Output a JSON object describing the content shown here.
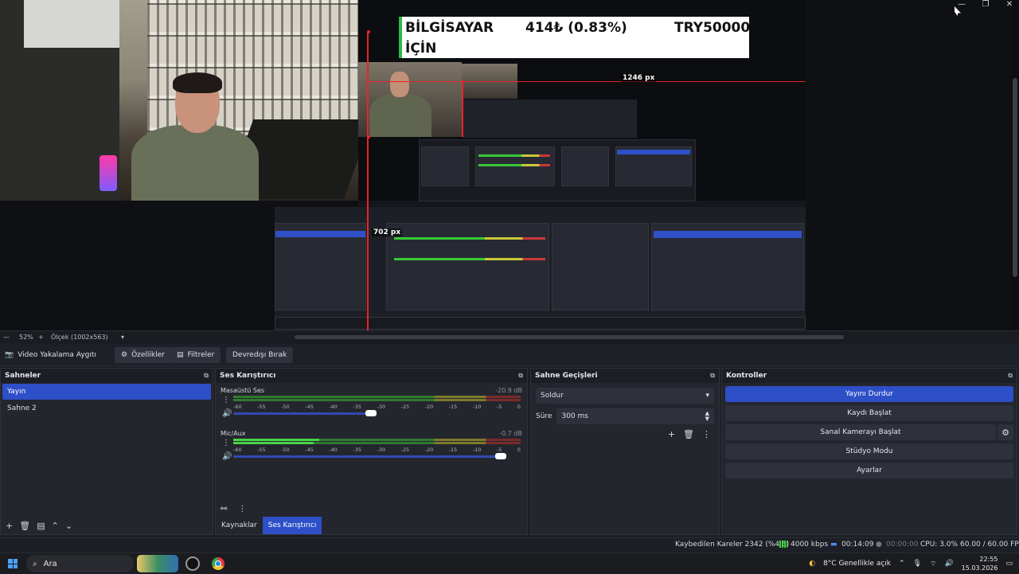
{
  "window": {
    "controls": [
      "—",
      "❐",
      "✕"
    ]
  },
  "overlay": {
    "ticker_name_line1": "BİLGİSAYAR",
    "ticker_name_line2": "İÇİN",
    "ticker_price": "414₺ (0.83%)",
    "ticker_goal": "TRY50000",
    "measure_horizontal": "1246 px",
    "measure_vertical": "702 px"
  },
  "zoom_bar": {
    "minus": "—",
    "zoom_level": "52%",
    "plus": "+",
    "scale_label": "Ölçek (1002x563)"
  },
  "source_bar": {
    "source_name": "Video Yakalama Aygıtı",
    "properties_label": "Özellikler",
    "filters_label": "Filtreler",
    "deactivate_label": "Devredışı Bırak"
  },
  "scenes": {
    "title": "Sahneler",
    "items": [
      "Yayın",
      "Sahne 2"
    ],
    "selected": "Yayın"
  },
  "mixer": {
    "title": "Ses Karıştırıcı",
    "channels": [
      {
        "name": "Masaüstü Ses",
        "db": "-20.9 dB",
        "level": 0.6,
        "volume": 0.6
      },
      {
        "name": "Mic/Aux",
        "db": "-0.7 dB",
        "level": 0.3,
        "volume": 0.95
      }
    ],
    "scale": [
      "-60",
      "-55",
      "-50",
      "-45",
      "-40",
      "-35",
      "-30",
      "-25",
      "-20",
      "-15",
      "-10",
      "-5",
      "0"
    ],
    "tabs": [
      "Kaynaklar",
      "Ses Karıştırıcı"
    ],
    "selected_tab": "Ses Karıştırıcı"
  },
  "transitions": {
    "title": "Sahne Geçişleri",
    "selected_transition": "Soldur",
    "duration_label": "Süre",
    "duration_value": "300 ms"
  },
  "controls": {
    "title": "Kontroller",
    "buttons": [
      "Yayını Durdur",
      "Kaydı Başlat",
      "Sanal Kamerayı Başlat",
      "Stüdyo Modu",
      "Ayarlar"
    ],
    "active_button": "Yayını Durdur"
  },
  "status": {
    "dropped_frames": "Kaybedilen Kareler 2342 (%4.6)",
    "bitrate": "4000 kbps",
    "stream_time": "00:14:09",
    "record_time": "00:00:00",
    "cpu": "CPU: 3.0%",
    "fps": "60.00 / 60.00 FPS"
  },
  "taskbar": {
    "search_placeholder": "Ara",
    "weather": "8°C  Genellikle açık",
    "time": "22:55",
    "date": "15.03.2026"
  },
  "colors": {
    "accent": "#2d4fc7",
    "danger": "#e8242b",
    "ticker_bar": "#2fb84a"
  }
}
